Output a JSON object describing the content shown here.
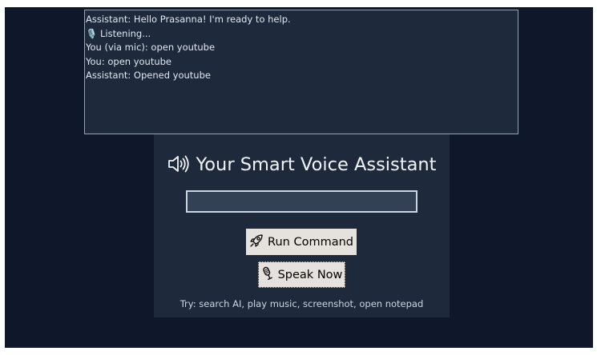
{
  "log": {
    "lines": [
      "Assistant: Hello Prasanna! I'm ready to help.",
      "🎙️ Listening...",
      "You (via mic): open youtube",
      "You: open youtube",
      "Assistant: Opened youtube"
    ]
  },
  "header": {
    "title": "Your Smart Voice Assistant",
    "icon": "speaker-icon"
  },
  "command_input": {
    "value": ""
  },
  "buttons": {
    "run_label": "Run Command",
    "run_icon": "rocket-icon",
    "speak_label": "Speak Now",
    "speak_icon": "microphone-icon"
  },
  "hint": "Try: search AI, play music, screenshot, open notepad",
  "colors": {
    "window_bg": "#0f172a",
    "panel_bg": "#1e293b",
    "input_bg": "#334155",
    "button_bg": "#e5e1dc",
    "text_light": "#f1f5f9"
  }
}
